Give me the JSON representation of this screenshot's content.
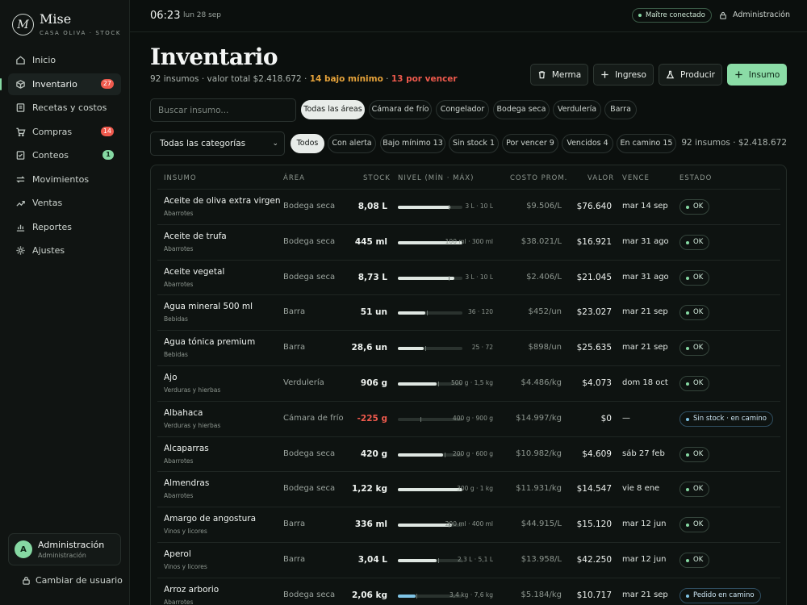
{
  "brand": {
    "logo_letter": "M",
    "name": "Mise",
    "subtitle": "CASA OLIVA · STOCK"
  },
  "nav": [
    {
      "label": "Inicio",
      "icon": "home-icon"
    },
    {
      "label": "Inventario",
      "icon": "box-icon",
      "badge": "27",
      "active": true
    },
    {
      "label": "Recetas y costos",
      "icon": "book-icon"
    },
    {
      "label": "Compras",
      "icon": "cart-icon",
      "badge": "14"
    },
    {
      "label": "Conteos",
      "icon": "checklist-icon",
      "badge": "1"
    },
    {
      "label": "Movimientos",
      "icon": "arrows-icon"
    },
    {
      "label": "Ventas",
      "icon": "sales-icon"
    },
    {
      "label": "Reportes",
      "icon": "chart-icon"
    },
    {
      "label": "Ajustes",
      "icon": "gear-icon"
    }
  ],
  "user": {
    "initial": "A",
    "name": "Administración",
    "role": "Administración",
    "switch_label": "Cambiar de usuario"
  },
  "topbar": {
    "time": "06:23",
    "date": "lun 28 sep",
    "status": "Maître conectado",
    "admin": "Administración"
  },
  "header": {
    "title": "Inventario",
    "count": "92 insumos",
    "total": "valor total $2.418.672",
    "low": "14 bajo mínimo",
    "expiring": "13 por vencer",
    "buttons": {
      "merma": "Merma",
      "ingreso": "Ingreso",
      "producir": "Producir",
      "insumo": "Insumo"
    }
  },
  "filters": {
    "search_placeholder": "Buscar insumo...",
    "areas": [
      "Todas las áreas",
      "Cámara de frío",
      "Congelador",
      "Bodega seca",
      "Verdulería",
      "Barra"
    ],
    "category_select": "Todas las categorías",
    "states": [
      "Todos",
      "Con alerta",
      "Bajo mínimo 13",
      "Sin stock 1",
      "Por vencer 9",
      "Vencidos 4",
      "En camino 15"
    ],
    "summary": "92 insumos · $2.418.672"
  },
  "table": {
    "headers": [
      "INSUMO",
      "ÁREA",
      "STOCK",
      "NIVEL (MÍN · MÁX)",
      "COSTO PROM.",
      "VALOR",
      "VENCE",
      "ESTADO"
    ],
    "rows": [
      {
        "name": "Aceite de oliva extra virgen",
        "category": "Abarrotes",
        "area": "Bodega seca",
        "stock": "8,08 L",
        "level": 0.81,
        "range": "3 L · 10 L",
        "cost": "$9.506/L",
        "value": "$76.640",
        "due": "mar 14 sep",
        "state": "OK"
      },
      {
        "name": "Aceite de trufa",
        "category": "Abarrotes",
        "area": "Bodega seca",
        "stock": "445 ml",
        "level": 1.0,
        "range": "100 ml · 300 ml",
        "cost": "$38.021/L",
        "value": "$16.921",
        "due": "mar 31 ago",
        "state": "OK"
      },
      {
        "name": "Aceite vegetal",
        "category": "Abarrotes",
        "area": "Bodega seca",
        "stock": "8,73 L",
        "level": 0.87,
        "range": "3 L · 10 L",
        "cost": "$2.406/L",
        "value": "$21.045",
        "due": "mar 31 ago",
        "state": "OK"
      },
      {
        "name": "Agua mineral 500 ml",
        "category": "Bebidas",
        "area": "Barra",
        "stock": "51 un",
        "level": 0.43,
        "range": "36 · 120",
        "cost": "$452/un",
        "value": "$23.027",
        "due": "mar 21 sep",
        "state": "OK"
      },
      {
        "name": "Agua tónica premium",
        "category": "Bebidas",
        "area": "Barra",
        "stock": "28,6 un",
        "level": 0.4,
        "range": "25 · 72",
        "cost": "$898/un",
        "value": "$25.635",
        "due": "mar 21 sep",
        "state": "OK"
      },
      {
        "name": "Ajo",
        "category": "Verduras y hierbas",
        "area": "Verdulería",
        "stock": "906 g",
        "level": 0.6,
        "range": "500 g · 1,5 kg",
        "cost": "$4.486/kg",
        "value": "$4.073",
        "due": "dom 18 oct",
        "state": "OK"
      },
      {
        "name": "Albahaca",
        "category": "Verduras y hierbas",
        "area": "Cámara de frío",
        "stock": "-225 g",
        "level": 0.0,
        "range": "400 g · 900 g",
        "cost": "$14.997/kg",
        "value": "$0",
        "due": "—",
        "state": "Sin stock · en camino"
      },
      {
        "name": "Alcaparras",
        "category": "Abarrotes",
        "area": "Bodega seca",
        "stock": "420 g",
        "level": 0.7,
        "range": "200 g · 600 g",
        "cost": "$10.982/kg",
        "value": "$4.609",
        "due": "sáb 27 feb",
        "state": "OK"
      },
      {
        "name": "Almendras",
        "category": "Abarrotes",
        "area": "Bodega seca",
        "stock": "1,22 kg",
        "level": 1.0,
        "range": "300 g · 1 kg",
        "cost": "$11.931/kg",
        "value": "$14.547",
        "due": "vie 8 ene",
        "state": "OK"
      },
      {
        "name": "Amargo de angostura",
        "category": "Vinos y licores",
        "area": "Barra",
        "stock": "336 ml",
        "level": 0.84,
        "range": "200 ml · 400 ml",
        "cost": "$44.915/L",
        "value": "$15.120",
        "due": "mar 12 jun",
        "state": "OK"
      },
      {
        "name": "Aperol",
        "category": "Vinos y licores",
        "area": "Barra",
        "stock": "3,04 L",
        "level": 0.6,
        "range": "2,3 L · 5,1 L",
        "cost": "$13.958/L",
        "value": "$42.250",
        "due": "mar 12 jun",
        "state": "OK"
      },
      {
        "name": "Arroz arborio",
        "category": "Abarrotes",
        "area": "Bodega seca",
        "stock": "2,06 kg",
        "level": 0.27,
        "range": "3,4 kg · 7,6 kg",
        "cost": "$5.184/kg",
        "value": "$10.717",
        "due": "mar 21 sep",
        "state": "Pedido en camino"
      }
    ]
  },
  "colors": {
    "accent": "#86d9a3",
    "warning": "#e5a23a",
    "danger": "#ef5a4d",
    "transit": "#7fc4e6"
  }
}
